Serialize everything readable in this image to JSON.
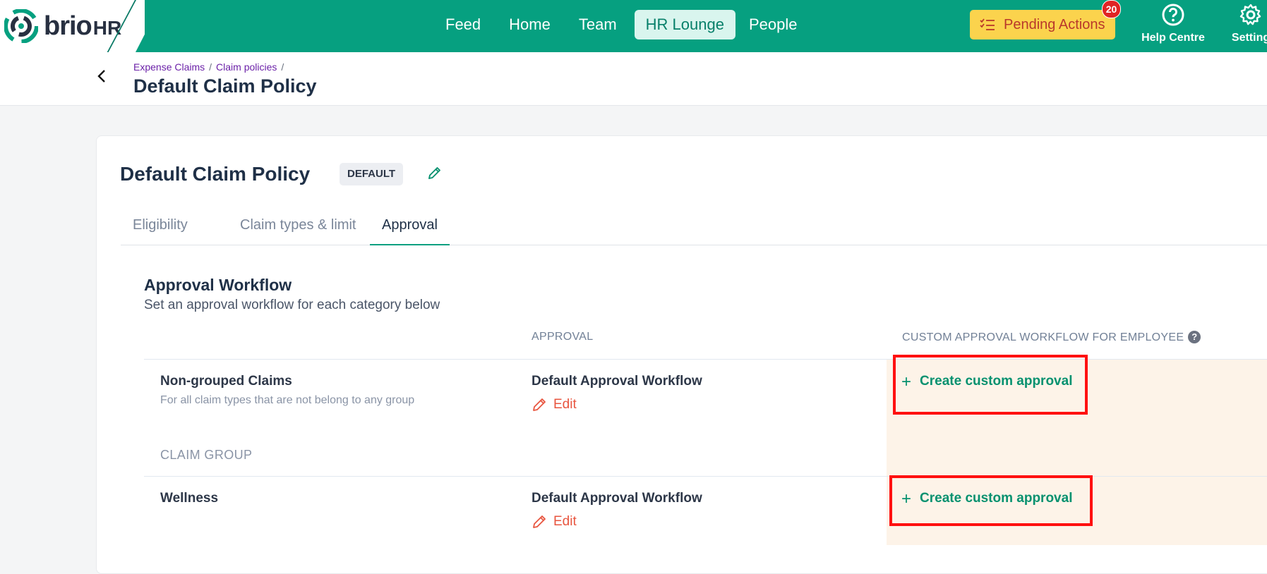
{
  "brand": {
    "name": "brio",
    "suffix": "HR"
  },
  "nav": {
    "items": [
      {
        "label": "Feed"
      },
      {
        "label": "Home"
      },
      {
        "label": "Team"
      },
      {
        "label": "HR Lounge"
      },
      {
        "label": "People"
      }
    ],
    "active": "HR Lounge"
  },
  "pending": {
    "label": "Pending Actions",
    "count": "20"
  },
  "help": {
    "label": "Help Centre"
  },
  "settings": {
    "label": "Setting"
  },
  "breadcrumb": {
    "items": [
      "Expense Claims",
      "Claim policies"
    ]
  },
  "page": {
    "title": "Default Claim Policy"
  },
  "card": {
    "title": "Default Claim Policy",
    "badge": "DEFAULT",
    "tabs": [
      "Eligibility",
      "Claim types & limit",
      "Approval"
    ],
    "active_tab": "Approval"
  },
  "workflow": {
    "title": "Approval Workflow",
    "subtitle": "Set an approval workflow for each category below",
    "col_approval": "APPROVAL",
    "col_custom": "CUSTOM APPROVAL WORKFLOW FOR EMPLOYEE",
    "group_label": "CLAIM GROUP",
    "rows": [
      {
        "title": "Non-grouped Claims",
        "description": "For all claim types that are not belong to any group",
        "approval": "Default Approval Workflow",
        "edit": "Edit",
        "custom": "Create custom approval"
      },
      {
        "title": "Wellness",
        "approval": "Default Approval Workflow",
        "edit": "Edit",
        "custom": "Create custom approval"
      }
    ]
  },
  "colors": {
    "brand_green": "#06a080",
    "accent_red": "#e8553f",
    "highlight": "#ff1010",
    "pending_yellow": "#fbd34d"
  }
}
